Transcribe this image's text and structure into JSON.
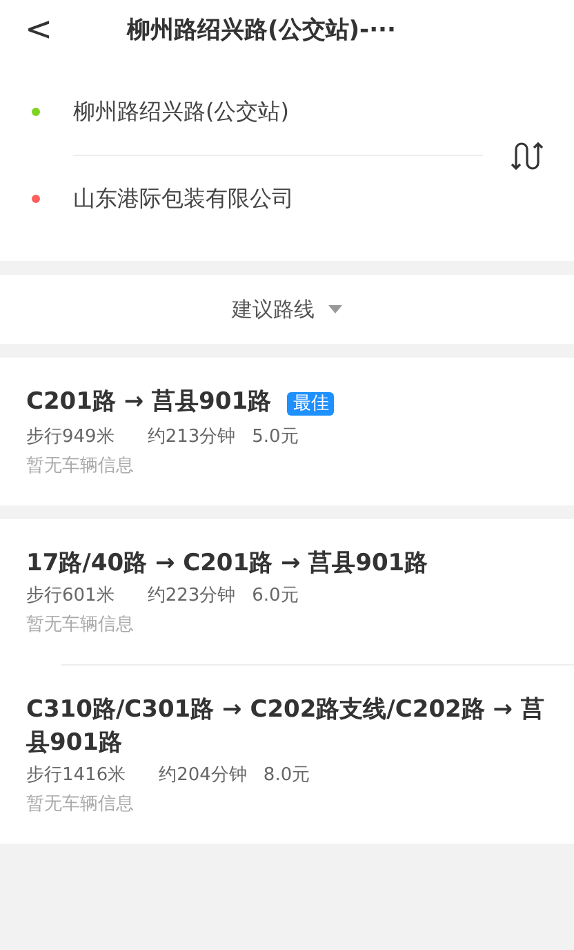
{
  "header": {
    "back": "<",
    "title": "柳州路绍兴路(公交站)-···"
  },
  "stops": [
    {
      "name": "柳州路绍兴路(公交站)",
      "color": "#7ed321"
    },
    {
      "name": "山东港际包装有限公司",
      "color": "#ff5f5f"
    }
  ],
  "sort": {
    "label": "建议路线"
  },
  "groups": [
    [
      {
        "title": "C201路 → 莒县901路",
        "badge": "最佳",
        "walk": "步行949米",
        "time": "约213分钟",
        "fare": "5.0元",
        "status": "暂无车辆信息"
      }
    ],
    [
      {
        "title": "17路/40路 → C201路 → 莒县901路",
        "walk": "步行601米",
        "time": "约223分钟",
        "fare": "6.0元",
        "status": "暂无车辆信息"
      },
      {
        "title": "C310路/C301路 → C202路支线/C202路 → 莒县901路",
        "walk": "步行1416米",
        "time": "约204分钟",
        "fare": "8.0元",
        "status": "暂无车辆信息"
      }
    ]
  ]
}
